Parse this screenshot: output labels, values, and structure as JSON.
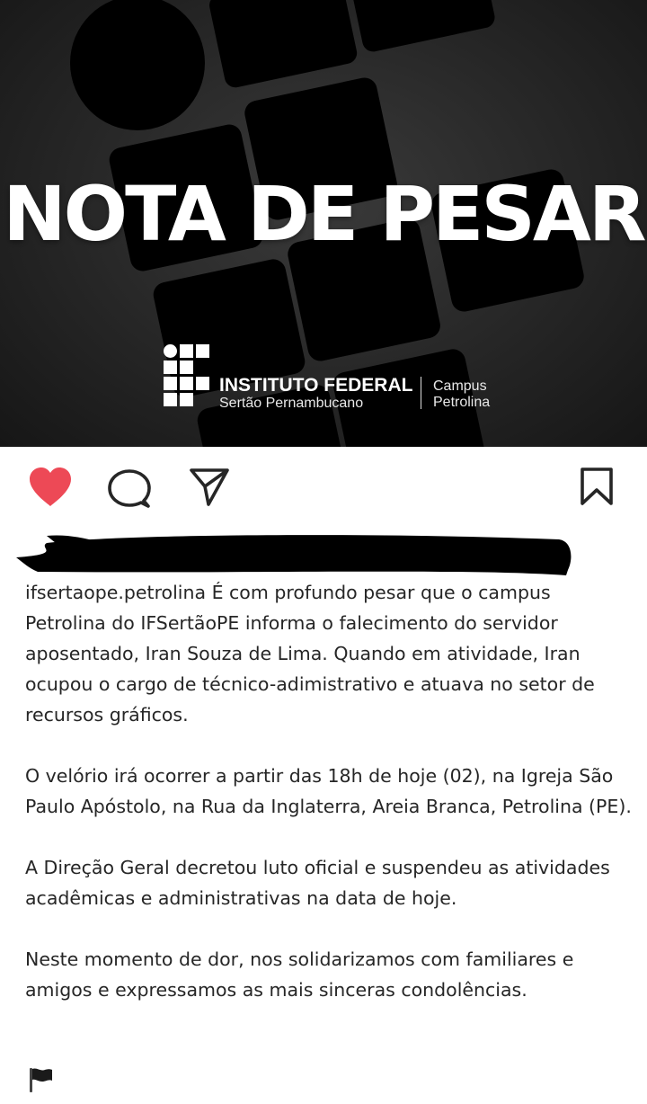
{
  "post_image": {
    "headline": "NOTA DE PESAR",
    "logo": {
      "name": "INSTITUTO FEDERAL",
      "subtitle": "Sertão Pernambucano",
      "campus_line1": "Campus",
      "campus_line2": "Petrolina"
    }
  },
  "actions": {
    "like_icon": "heart-filled-icon",
    "comment_icon": "comment-bubble-icon",
    "share_icon": "paper-plane-icon",
    "save_icon": "bookmark-icon",
    "like_color": "#ed4956"
  },
  "caption": {
    "username": "ifsertaope.petrolina",
    "paragraph1": " É com profundo pesar que o campus Petrolina do IFSertãoPE informa o falecimento do servidor aposentado, Iran Souza de Lima. Quando em atividade, Iran ocupou o cargo de técnico-adimistrativo e atuava no setor de recursos gráficos.",
    "paragraph2": "O velório irá ocorrer a partir das 18h de hoje (02), na Igreja São Paulo Apóstolo, na Rua da Inglaterra, Areia Branca, Petrolina (PE).",
    "paragraph3": "A Direção Geral decretou luto oficial e suspendeu as atividades acadêmicas e administrativas na data de hoje.",
    "paragraph4": "Neste momento de dor, nos solidarizamos com familiares e amigos e expressamos as mais sinceras condolências.",
    "trailing_emoji": "black-flag-icon"
  }
}
